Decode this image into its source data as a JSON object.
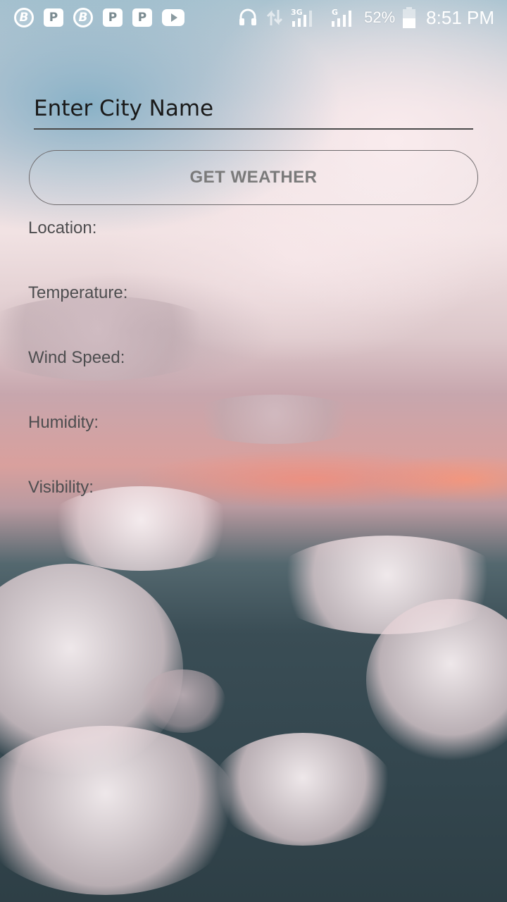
{
  "status_bar": {
    "left_icons": [
      "b-app-icon",
      "p-app-icon",
      "b-app-icon",
      "p-app-icon",
      "p-app-icon",
      "youtube-icon"
    ],
    "b_letter": "B",
    "p_letter": "P",
    "network_3g": "3G",
    "network_g": "G",
    "battery_percent": "52%",
    "battery_level": 0.52,
    "time": "8:51 PM"
  },
  "form": {
    "city_input_placeholder": "Enter City Name",
    "city_input_value": "",
    "get_weather_label": "GET WEATHER"
  },
  "weather_info": {
    "location_label": "Location:",
    "temperature_label": "Temperature:",
    "wind_speed_label": "Wind Speed:",
    "humidity_label": "Humidity:",
    "visibility_label": "Visibility:"
  },
  "colors": {
    "status_text": "#ffffff",
    "input_text": "#1a1a1a",
    "button_text": "#7a7a7a",
    "label_text": "#4d4d4f"
  }
}
